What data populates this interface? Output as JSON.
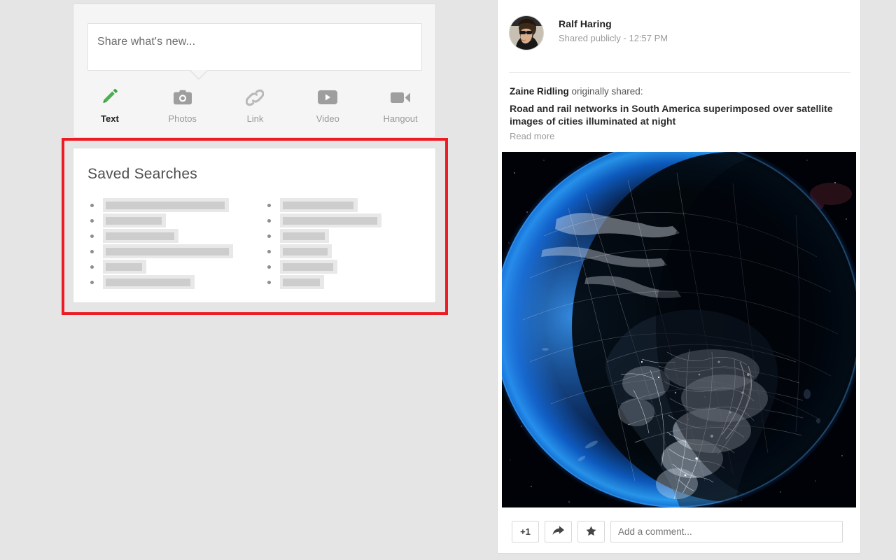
{
  "page": {
    "background_color": "#e5e5e5",
    "highlight_color": "#ed1c24"
  },
  "composer": {
    "placeholder": "Share what's new...",
    "tabs": [
      {
        "label": "Text",
        "icon": "pencil-icon",
        "active": true,
        "color": "#4caf50"
      },
      {
        "label": "Photos",
        "icon": "camera-icon",
        "active": false,
        "color": "#9e9e9e"
      },
      {
        "label": "Link",
        "icon": "link-chain-icon",
        "active": false,
        "color": "#b5b5b5"
      },
      {
        "label": "Video",
        "icon": "video-play-icon",
        "active": false,
        "color": "#9e9e9e"
      },
      {
        "label": "Hangout",
        "icon": "video-camera-icon",
        "active": false,
        "color": "#9e9e9e"
      }
    ]
  },
  "saved_searches": {
    "title": "Saved Searches",
    "left_column": [
      {
        "outer_width": 180,
        "inner_width": 170
      },
      {
        "outer_width": 90,
        "inner_width": 80
      },
      {
        "outer_width": 108,
        "inner_width": 98
      },
      {
        "outer_width": 186,
        "inner_width": 176
      },
      {
        "outer_width": 62,
        "inner_width": 52
      },
      {
        "outer_width": 131,
        "inner_width": 121
      }
    ],
    "right_column": [
      {
        "outer_width": 111,
        "inner_width": 101
      },
      {
        "outer_width": 145,
        "inner_width": 135
      },
      {
        "outer_width": 70,
        "inner_width": 60
      },
      {
        "outer_width": 74,
        "inner_width": 64
      },
      {
        "outer_width": 82,
        "inner_width": 72
      },
      {
        "outer_width": 63,
        "inner_width": 53
      }
    ]
  },
  "post": {
    "author": "Ralf Haring",
    "visibility": "Shared publicly",
    "separator": "-",
    "time": "12:57 PM",
    "reshare_author": "Zaine Ridling",
    "reshare_suffix": " originally shared:",
    "title": "Road and rail networks in South America superimposed over satellite images of cities illuminated at night",
    "read_more": "Read more",
    "image_alt": "night-earth-globe-south-america",
    "actions": {
      "plus_one": "+1",
      "share_icon": "share-arrow-icon",
      "star_icon": "star-icon",
      "comment_placeholder": "Add a comment..."
    }
  }
}
